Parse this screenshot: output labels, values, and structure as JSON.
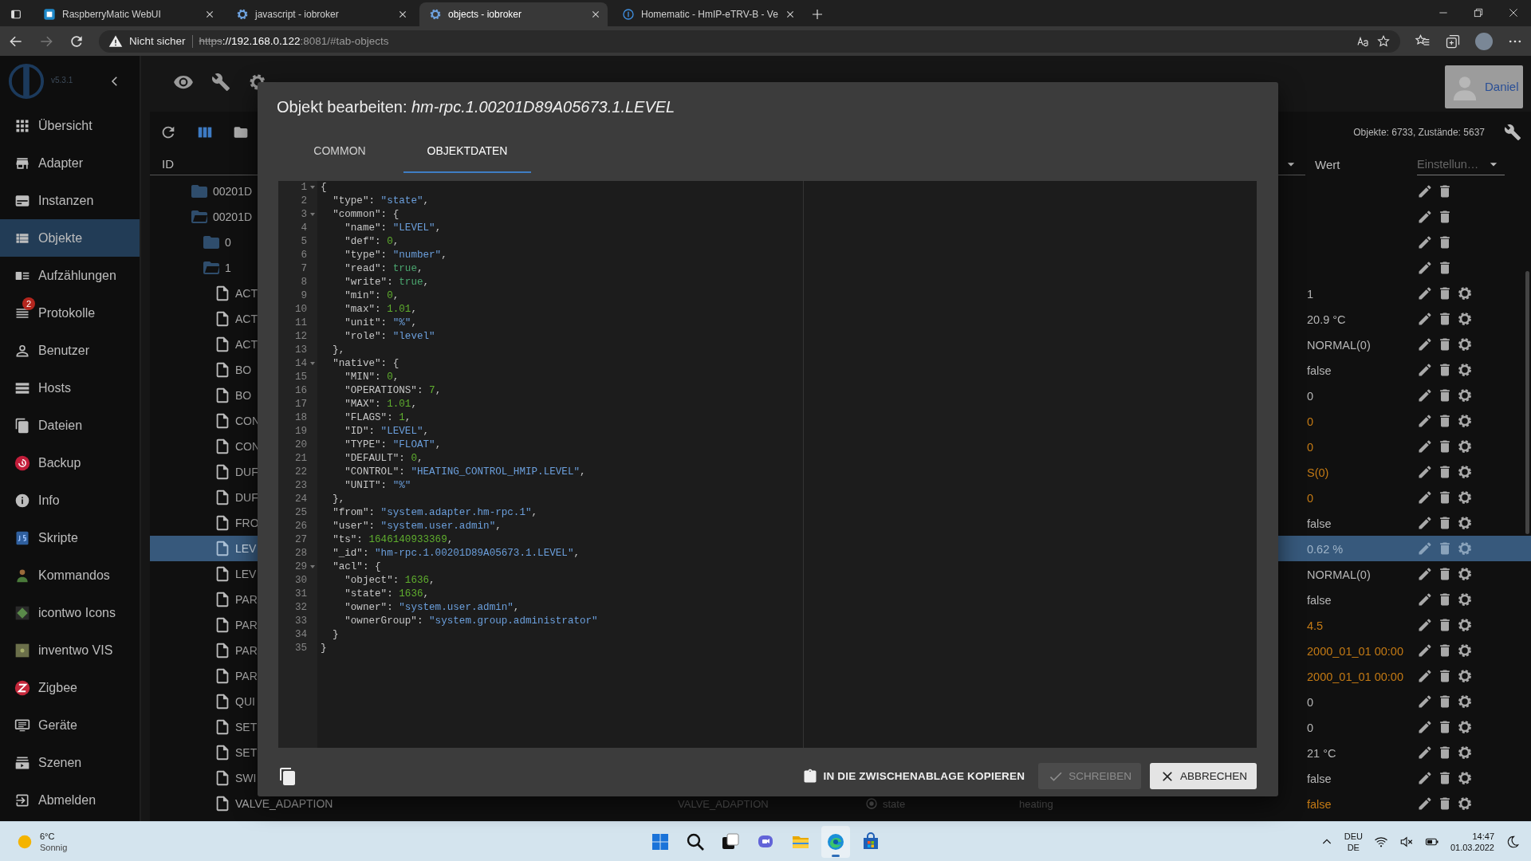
{
  "browser": {
    "tabs": [
      {
        "title": "RaspberryMatic WebUI",
        "selected": false
      },
      {
        "title": "javascript - iobroker",
        "selected": false
      },
      {
        "title": "objects - iobroker",
        "selected": true
      },
      {
        "title": "Homematic - HmIP-eTRV-B - Ve",
        "selected": false
      }
    ],
    "security_label": "Nicht sicher",
    "url": {
      "scheme": "https",
      "host": "://192.168.0.122",
      "rest": ":8081/#tab-objects"
    }
  },
  "sidebar": {
    "version": "v5.3.1",
    "items": [
      {
        "label": "Übersicht",
        "selected": false
      },
      {
        "label": "Adapter",
        "selected": false
      },
      {
        "label": "Instanzen",
        "selected": false
      },
      {
        "label": "Objekte",
        "selected": true
      },
      {
        "label": "Aufzählungen",
        "selected": false
      },
      {
        "label": "Protokolle",
        "selected": false,
        "badge": "2"
      },
      {
        "label": "Benutzer",
        "selected": false
      },
      {
        "label": "Hosts",
        "selected": false
      },
      {
        "label": "Dateien",
        "selected": false
      },
      {
        "label": "Backup",
        "selected": false
      },
      {
        "label": "Info",
        "selected": false
      },
      {
        "label": "Skripte",
        "selected": false
      },
      {
        "label": "Kommandos",
        "selected": false
      },
      {
        "label": "icontwo Icons",
        "selected": false
      },
      {
        "label": "inventwo VIS",
        "selected": false
      },
      {
        "label": "Zigbee",
        "selected": false
      },
      {
        "label": "Geräte",
        "selected": false
      },
      {
        "label": "Szenen",
        "selected": false
      },
      {
        "label": "Abmelden",
        "selected": false
      }
    ]
  },
  "user": {
    "name": "Daniel"
  },
  "table": {
    "count_label": "Objekte: 6733, Zustände: 5637",
    "id_heading": "ID",
    "value_heading": "Wert",
    "settings_filter": {
      "placeholder": "Einstellun…"
    },
    "tree": [
      {
        "name": "00201D",
        "kind": "folder",
        "expanded": false
      },
      {
        "name": "00201D",
        "kind": "folder",
        "expanded": true,
        "children": [
          {
            "name": "0",
            "kind": "folder",
            "expanded": false
          },
          {
            "name": "1",
            "kind": "folder",
            "expanded": true,
            "children": [
              {
                "name": "ACT",
                "kind": "file",
                "value": "1",
                "ack": true,
                "selected": false
              },
              {
                "name": "ACT",
                "kind": "file",
                "value": "20.9 °C",
                "ack": true,
                "selected": false
              },
              {
                "name": "ACT",
                "kind": "file",
                "value": "NORMAL(0)",
                "ack": true,
                "selected": false
              },
              {
                "name": "BO",
                "kind": "file",
                "value": "false",
                "ack": true,
                "selected": false
              },
              {
                "name": "BO",
                "kind": "file",
                "value": "0",
                "ack": true,
                "selected": false
              },
              {
                "name": "CON",
                "kind": "file",
                "value": "0",
                "ack": false,
                "selected": false
              },
              {
                "name": "CON",
                "kind": "file",
                "value": "0",
                "ack": false,
                "selected": false
              },
              {
                "name": "DUF",
                "kind": "file",
                "value": "S(0)",
                "ack": false,
                "selected": false
              },
              {
                "name": "DUF",
                "kind": "file",
                "value": "0",
                "ack": false,
                "selected": false
              },
              {
                "name": "FRO",
                "kind": "file",
                "value": "false",
                "ack": true,
                "selected": false
              },
              {
                "name": "LEV",
                "kind": "file",
                "value": "0.62 %",
                "ack": true,
                "selected": true
              },
              {
                "name": "LEV",
                "kind": "file",
                "value": "NORMAL(0)",
                "ack": true,
                "selected": false
              },
              {
                "name": "PAR",
                "kind": "file",
                "value": "false",
                "ack": true,
                "selected": false
              },
              {
                "name": "PAR",
                "kind": "file",
                "value": "4.5",
                "ack": false,
                "selected": false
              },
              {
                "name": "PAR",
                "kind": "file",
                "value": "2000_01_01 00:00",
                "ack": false,
                "selected": false
              },
              {
                "name": "PAR",
                "kind": "file",
                "value": "2000_01_01 00:00",
                "ack": false,
                "selected": false
              },
              {
                "name": "QUI",
                "kind": "file",
                "value": "0",
                "ack": true,
                "selected": false
              },
              {
                "name": "SET",
                "kind": "file",
                "value": "0",
                "ack": true,
                "selected": false
              },
              {
                "name": "SET",
                "kind": "file",
                "value": "21 °C",
                "ack": true,
                "selected": false
              },
              {
                "name": "SWI",
                "kind": "file",
                "value": "false",
                "ack": true,
                "selected": false
              },
              {
                "name": "VALVE_ADAPTION",
                "kind": "file",
                "value": "false",
                "ack": false,
                "selected": false,
                "column_2": "VALVE_ADAPTION",
                "column_3": "state",
                "column_4": "heating"
              }
            ]
          }
        ]
      }
    ]
  },
  "dialog": {
    "title": "Objekt bearbeiten: *hm-rpc.1.00201D89A05673.1.LEVEL*",
    "tabs": [
      {
        "label": "COMMON",
        "selected": false
      },
      {
        "label": "OBJEKTDATEN",
        "selected": true
      }
    ],
    "editor": {
      "lines": [
        {
          "no": "1",
          "code": "{",
          "fold": true
        },
        {
          "no": "2",
          "code": "  \"type\": \"state\",",
          "fold": false
        },
        {
          "no": "3",
          "code": "  \"common\": {",
          "fold": true
        },
        {
          "no": "4",
          "code": "    \"name\": \"LEVEL\",",
          "fold": false
        },
        {
          "no": "5",
          "code": "    \"def\": 0,",
          "fold": false
        },
        {
          "no": "6",
          "code": "    \"type\": \"number\",",
          "fold": false
        },
        {
          "no": "7",
          "code": "    \"read\": true,",
          "fold": false
        },
        {
          "no": "8",
          "code": "    \"write\": true,",
          "fold": false
        },
        {
          "no": "9",
          "code": "    \"min\": 0,",
          "fold": false
        },
        {
          "no": "10",
          "code": "    \"max\": 1.01,",
          "fold": false
        },
        {
          "no": "11",
          "code": "    \"unit\": \"%\",",
          "fold": false
        },
        {
          "no": "12",
          "code": "    \"role\": \"level\"",
          "fold": false
        },
        {
          "no": "13",
          "code": "  },",
          "fold": false
        },
        {
          "no": "14",
          "code": "  \"native\": {",
          "fold": true
        },
        {
          "no": "15",
          "code": "    \"MIN\": 0,",
          "fold": false
        },
        {
          "no": "16",
          "code": "    \"OPERATIONS\": 7,",
          "fold": false
        },
        {
          "no": "17",
          "code": "    \"MAX\": 1.01,",
          "fold": false
        },
        {
          "no": "18",
          "code": "    \"FLAGS\": 1,",
          "fold": false
        },
        {
          "no": "19",
          "code": "    \"ID\": \"LEVEL\",",
          "fold": false
        },
        {
          "no": "20",
          "code": "    \"TYPE\": \"FLOAT\",",
          "fold": false
        },
        {
          "no": "21",
          "code": "    \"DEFAULT\": 0,",
          "fold": false
        },
        {
          "no": "22",
          "code": "    \"CONTROL\": \"HEATING_CONTROL_HMIP.LEVEL\",",
          "fold": false
        },
        {
          "no": "23",
          "code": "    \"UNIT\": \"%\"",
          "fold": false
        },
        {
          "no": "24",
          "code": "  },",
          "fold": false
        },
        {
          "no": "25",
          "code": "  \"from\": \"system.adapter.hm-rpc.1\",",
          "fold": false
        },
        {
          "no": "26",
          "code": "  \"user\": \"system.user.admin\",",
          "fold": false
        },
        {
          "no": "27",
          "code": "  \"ts\": 1646140933369,",
          "fold": false
        },
        {
          "no": "28",
          "code": "  \"_id\": \"hm-rpc.1.00201D89A05673.1.LEVEL\",",
          "fold": false
        },
        {
          "no": "29",
          "code": "  \"acl\": {",
          "fold": true
        },
        {
          "no": "30",
          "code": "    \"object\": 1636,",
          "fold": false
        },
        {
          "no": "31",
          "code": "    \"state\": 1636,",
          "fold": false
        },
        {
          "no": "32",
          "code": "    \"owner\": \"system.user.admin\",",
          "fold": false
        },
        {
          "no": "33",
          "code": "    \"ownerGroup\": \"system.group.administrator\"",
          "fold": false
        },
        {
          "no": "34",
          "code": "  }",
          "fold": false
        },
        {
          "no": "35",
          "code": "}",
          "fold": false
        }
      ]
    },
    "copy_button": "IN DIE ZWISCHENABLAGE KOPIEREN",
    "buttons": [
      {
        "label": "SCHREIBEN",
        "kind": "confirm",
        "disabled": true
      },
      {
        "label": "ABBRECHEN",
        "kind": "cancel",
        "disabled": false
      }
    ]
  },
  "taskbar": {
    "weather": {
      "temperature": "6°C",
      "condition": "Sonnig"
    },
    "apps": [
      {
        "kind": "start",
        "active": false
      },
      {
        "kind": "search",
        "active": false
      },
      {
        "kind": "taskview",
        "active": false
      },
      {
        "kind": "chat",
        "active": false
      },
      {
        "kind": "explorer",
        "active": false
      },
      {
        "kind": "browser",
        "active": true
      },
      {
        "kind": "store",
        "active": false
      }
    ],
    "language": {
      "top": "DEU",
      "bottom": "DE"
    },
    "time": "14:47",
    "date": "01.03.2022"
  }
}
